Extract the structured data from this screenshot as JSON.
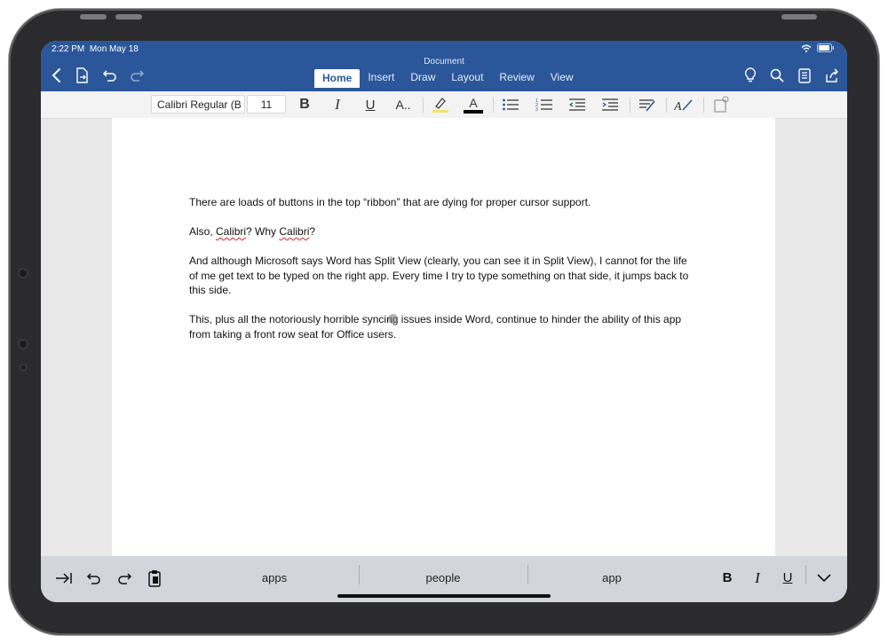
{
  "status": {
    "time": "2:22 PM",
    "date": "Mon May 18"
  },
  "document": {
    "title": "Document"
  },
  "toolbar_icons": [
    "back-chevron-icon",
    "file-icon",
    "undo-icon",
    "redo-icon",
    "lightbulb-icon",
    "search-icon",
    "reading-mode-icon",
    "share-icon"
  ],
  "tabs": [
    {
      "label": "Home",
      "active": true
    },
    {
      "label": "Insert"
    },
    {
      "label": "Draw"
    },
    {
      "label": "Layout"
    },
    {
      "label": "Review"
    },
    {
      "label": "View"
    }
  ],
  "ribbon": {
    "font_name": "Calibri Regular (B",
    "font_size": "11",
    "bold": "B",
    "italic": "I",
    "underline": "U",
    "more_text": "A..",
    "font_color_letter": "A",
    "font_color": "#000000",
    "highlight_color": "#f3e36b"
  },
  "body": {
    "p1": "There are loads of buttons in the top “ribbon” that are dying for proper cursor support.",
    "p2_a": "Also, ",
    "p2_b": "Calibri",
    "p2_c": "? Why ",
    "p2_d": "Calibri",
    "p2_e": "?",
    "p3": "And although Microsoft says Word has Split View (clearly, you can see it in Split View), I cannot for the life of me get text to be typed on the right app. Every time I try to type something on that side, it jumps back to this side.",
    "p4_a": "This, plus all the notoriously horrible syncing",
    "p4_b": " issues inside Word, continue to hinder the ability of this app from taking a front row seat for Office users."
  },
  "keyboard_bar": {
    "suggestions": [
      "apps",
      "people",
      "app"
    ],
    "bold": "B",
    "italic": "I",
    "underline": "U"
  },
  "colors": {
    "word_blue": "#2b579a",
    "ribbon_bg": "#f3f3f3",
    "kb_bg": "#d2d5db"
  }
}
